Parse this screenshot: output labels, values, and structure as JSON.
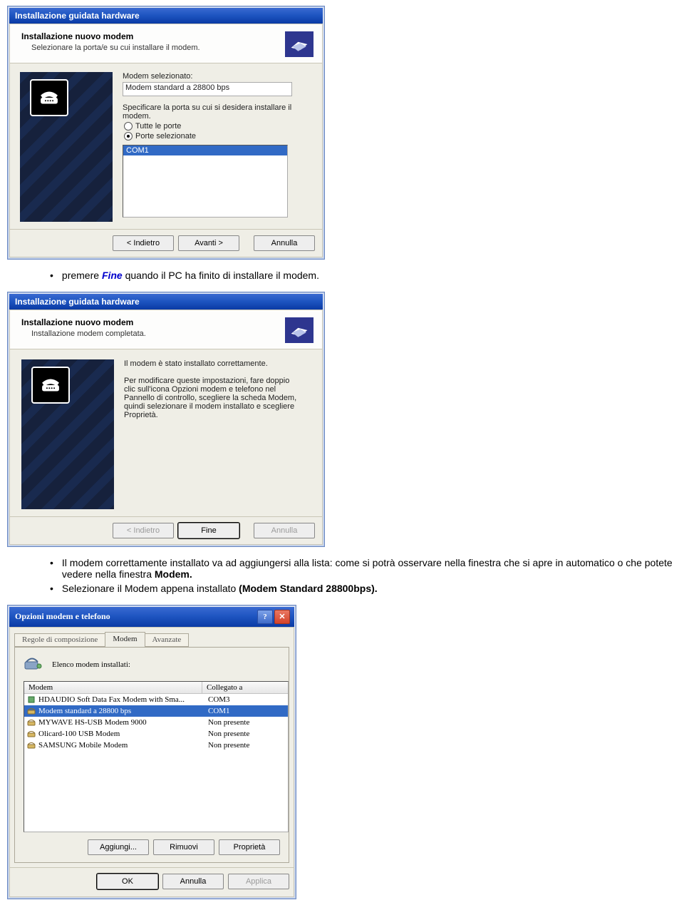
{
  "doc": {
    "bullet1_pre": "premere ",
    "fine_word": "Fine",
    "bullet1_post": " quando il PC ha finito di installare il modem.",
    "bullet2a": "Il modem correttamente installato va ad aggiungersi alla lista: come si potrà osservare nella finestra che si apre in automatico o che potete vedere nella finestra ",
    "bullet2_bold": "Modem.",
    "bullet3a": "Selezionare il Modem appena installato ",
    "bullet3_bold": "(Modem Standard 28800bps)."
  },
  "wizard1": {
    "title": "Installazione guidata hardware",
    "head_title": "Installazione nuovo modem",
    "head_sub": "Selezionare la porta/e su cui installare il modem.",
    "modem_label": "Modem selezionato:",
    "modem_value": "Modem standard a 28800 bps",
    "port_prompt": "Specificare la porta su cui si desidera installare il modem.",
    "radio_all": "Tutte le porte",
    "radio_sel": "Porte selezionate",
    "port_item": "COM1",
    "btn_back": "< Indietro",
    "btn_next": "Avanti >",
    "btn_cancel": "Annulla"
  },
  "wizard2": {
    "title": "Installazione guidata hardware",
    "head_title": "Installazione nuovo modem",
    "head_sub": "Installazione modem completata.",
    "msg_bold": "Il modem è stato installato correttamente.",
    "msg_body": "Per modificare queste impostazioni, fare doppio clic sull'icona Opzioni modem e telefono nel Pannello di controllo, scegliere la scheda Modem, quindi selezionare il modem installato e scegliere Proprietà.",
    "btn_back": "< Indietro",
    "btn_finish": "Fine",
    "btn_cancel": "Annulla"
  },
  "dialog3": {
    "title": "Opzioni modem e telefono",
    "tab_rules": "Regole di composizione",
    "tab_modem": "Modem",
    "tab_adv": "Avanzate",
    "list_label": "Elenco modem installati:",
    "col_modem": "Modem",
    "col_conn": "Collegato a",
    "rows": [
      {
        "name": "HDAUDIO Soft Data Fax Modem with Sma...",
        "conn": "COM3",
        "sel": false,
        "icon": "chip"
      },
      {
        "name": "Modem standard a 28800 bps",
        "conn": "COM1",
        "sel": true,
        "icon": "phone"
      },
      {
        "name": "MYWAVE HS-USB Modem 9000",
        "conn": "Non presente",
        "sel": false,
        "icon": "phone"
      },
      {
        "name": "Olicard-100 USB Modem",
        "conn": "Non presente",
        "sel": false,
        "icon": "phone"
      },
      {
        "name": "SAMSUNG Mobile Modem",
        "conn": "Non presente",
        "sel": false,
        "icon": "phone"
      }
    ],
    "btn_add": "Aggiungi...",
    "btn_remove": "Rimuovi",
    "btn_props": "Proprietà",
    "btn_ok": "OK",
    "btn_cancel": "Annulla",
    "btn_apply": "Applica"
  }
}
